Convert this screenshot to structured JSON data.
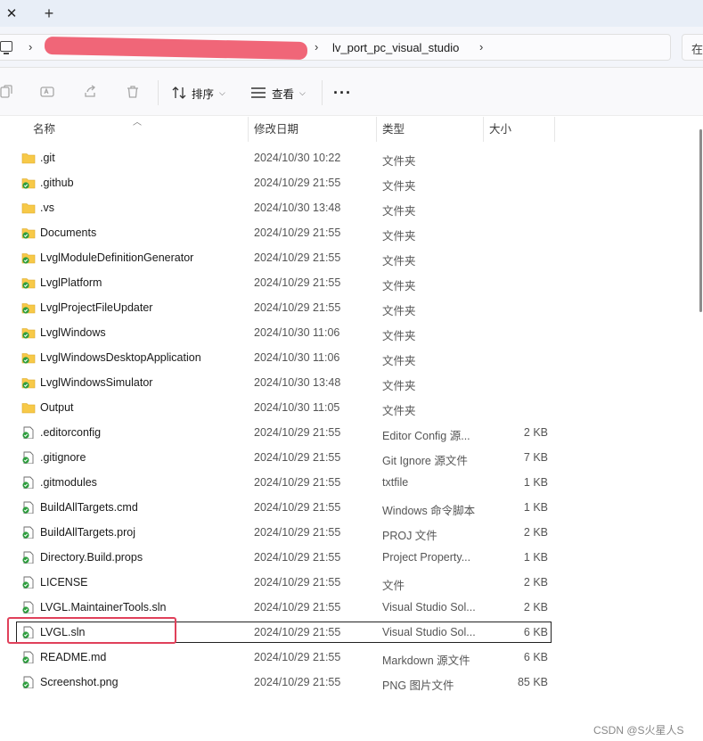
{
  "tabbar": {
    "close_glyph": "✕",
    "new_glyph": "+"
  },
  "address": {
    "chevron": "›",
    "current_folder": "lv_port_pc_visual_studio",
    "search_hint": "在"
  },
  "toolbar": {
    "sort_label": "排序",
    "view_label": "查看",
    "more_glyph": "···",
    "icons": [
      "copy-icon",
      "rename-icon",
      "share-icon",
      "delete-icon",
      "sort-icon",
      "view-icon"
    ]
  },
  "columns": {
    "name": "名称",
    "date": "修改日期",
    "type": "类型",
    "size": "大小"
  },
  "files": [
    {
      "name": ".git",
      "date": "2024/10/30 10:22",
      "type": "文件夹",
      "size": "",
      "icon": "folder"
    },
    {
      "name": ".github",
      "date": "2024/10/29 21:55",
      "type": "文件夹",
      "size": "",
      "icon": "folder-synced"
    },
    {
      "name": ".vs",
      "date": "2024/10/30 13:48",
      "type": "文件夹",
      "size": "",
      "icon": "folder"
    },
    {
      "name": "Documents",
      "date": "2024/10/29 21:55",
      "type": "文件夹",
      "size": "",
      "icon": "folder-synced"
    },
    {
      "name": "LvglModuleDefinitionGenerator",
      "date": "2024/10/29 21:55",
      "type": "文件夹",
      "size": "",
      "icon": "folder-synced"
    },
    {
      "name": "LvglPlatform",
      "date": "2024/10/29 21:55",
      "type": "文件夹",
      "size": "",
      "icon": "folder-synced"
    },
    {
      "name": "LvglProjectFileUpdater",
      "date": "2024/10/29 21:55",
      "type": "文件夹",
      "size": "",
      "icon": "folder-synced"
    },
    {
      "name": "LvglWindows",
      "date": "2024/10/30 11:06",
      "type": "文件夹",
      "size": "",
      "icon": "folder-synced"
    },
    {
      "name": "LvglWindowsDesktopApplication",
      "date": "2024/10/30 11:06",
      "type": "文件夹",
      "size": "",
      "icon": "folder-synced"
    },
    {
      "name": "LvglWindowsSimulator",
      "date": "2024/10/30 13:48",
      "type": "文件夹",
      "size": "",
      "icon": "folder-synced"
    },
    {
      "name": "Output",
      "date": "2024/10/30 11:05",
      "type": "文件夹",
      "size": "",
      "icon": "folder"
    },
    {
      "name": ".editorconfig",
      "date": "2024/10/29 21:55",
      "type": "Editor Config 源...",
      "size": "2 KB",
      "icon": "file-synced"
    },
    {
      "name": ".gitignore",
      "date": "2024/10/29 21:55",
      "type": "Git Ignore 源文件",
      "size": "7 KB",
      "icon": "file-synced"
    },
    {
      "name": ".gitmodules",
      "date": "2024/10/29 21:55",
      "type": "txtfile",
      "size": "1 KB",
      "icon": "file-synced"
    },
    {
      "name": "BuildAllTargets.cmd",
      "date": "2024/10/29 21:55",
      "type": "Windows 命令脚本",
      "size": "1 KB",
      "icon": "file-synced"
    },
    {
      "name": "BuildAllTargets.proj",
      "date": "2024/10/29 21:55",
      "type": "PROJ 文件",
      "size": "2 KB",
      "icon": "file-synced"
    },
    {
      "name": "Directory.Build.props",
      "date": "2024/10/29 21:55",
      "type": "Project Property...",
      "size": "1 KB",
      "icon": "file-synced"
    },
    {
      "name": "LICENSE",
      "date": "2024/10/29 21:55",
      "type": "文件",
      "size": "2 KB",
      "icon": "file-synced"
    },
    {
      "name": "LVGL.MaintainerTools.sln",
      "date": "2024/10/29 21:55",
      "type": "Visual Studio Sol...",
      "size": "2 KB",
      "icon": "file-synced"
    },
    {
      "name": "LVGL.sln",
      "date": "2024/10/29 21:55",
      "type": "Visual Studio Sol...",
      "size": "6 KB",
      "icon": "file-synced",
      "selected": true
    },
    {
      "name": "README.md",
      "date": "2024/10/29 21:55",
      "type": "Markdown 源文件",
      "size": "6 KB",
      "icon": "file-synced"
    },
    {
      "name": "Screenshot.png",
      "date": "2024/10/29 21:55",
      "type": "PNG 图片文件",
      "size": "85 KB",
      "icon": "file-synced"
    }
  ],
  "colors": {
    "folder": "#f7c948",
    "sync_green": "#2e9e3e",
    "highlight": "#e0405a"
  },
  "watermark": "CSDN @S火星人S"
}
